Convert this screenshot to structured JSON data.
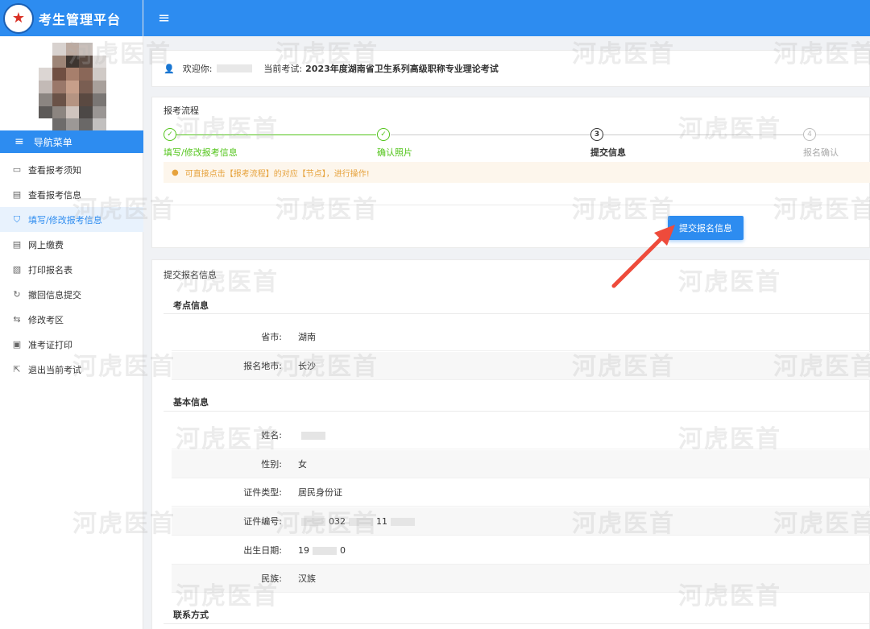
{
  "app": {
    "title": "考生管理平台"
  },
  "nav": {
    "header": "导航菜单",
    "items": [
      {
        "label": "查看报考须知",
        "icon": "message-icon"
      },
      {
        "label": "查看报考信息",
        "icon": "document-icon"
      },
      {
        "label": "填写/修改报考信息",
        "icon": "shield-check-icon",
        "active": true
      },
      {
        "label": "网上缴费",
        "icon": "document-icon"
      },
      {
        "label": "打印报名表",
        "icon": "print-form-icon"
      },
      {
        "label": "撤回信息提交",
        "icon": "refresh-icon"
      },
      {
        "label": "修改考区",
        "icon": "swap-icon"
      },
      {
        "label": "准考证打印",
        "icon": "card-icon"
      },
      {
        "label": "退出当前考试",
        "icon": "exit-icon"
      }
    ]
  },
  "welcome": {
    "greeting": "欢迎你:",
    "exam_label": "当前考试:",
    "exam_title": "2023年度湖南省卫生系列高级职称专业理论考试"
  },
  "process": {
    "title": "报考流程",
    "steps": [
      {
        "num": "✓",
        "label": "填写/修改报考信息",
        "state": "done"
      },
      {
        "num": "✓",
        "label": "确认照片",
        "state": "done"
      },
      {
        "num": "3",
        "label": "提交信息",
        "state": "current"
      },
      {
        "num": "4",
        "label": "报名确认",
        "state": "todo"
      }
    ],
    "tip": "可直接点击【报考流程】的对应【节点】，进行操作!"
  },
  "submit_button": "提交报名信息",
  "info": {
    "title": "提交报名信息",
    "exam_site_title": "考点信息",
    "province_label": "省市:",
    "province_value": "湖南",
    "city_label": "报名地市:",
    "city_value": "长沙",
    "basic_title": "基本信息",
    "name_label": "姓名:",
    "gender_label": "性别:",
    "gender_value": "女",
    "id_type_label": "证件类型:",
    "id_type_value": "居民身份证",
    "id_no_label": "证件编号:",
    "id_no_part1": "032",
    "id_no_part2": "11",
    "birth_label": "出生日期:",
    "birth_part1": "19",
    "birth_part2": "0",
    "ethnic_label": "民族:",
    "ethnic_value": "汉族",
    "contact_title": "联系方式"
  },
  "watermark": "河虎医首",
  "colors": {
    "primary": "#2d8cf0",
    "success": "#52c41a",
    "warning": "#e6a23c",
    "arrow": "#ee4b3b"
  }
}
